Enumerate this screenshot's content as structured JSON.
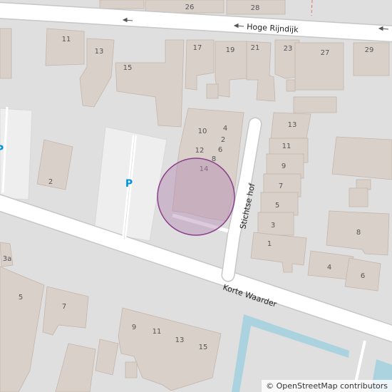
{
  "colors": {
    "land": "#e0dfdf",
    "building": "#d9d0c9",
    "building_stroke": "#c4b6ab",
    "road": "#ffffff",
    "road_casing": "#c7c7c7",
    "parking": "#eeeeee",
    "water": "#aad3df",
    "parking_icon": "#0092da",
    "marker_fill": "#b48ab4",
    "marker_stroke": "#8a3f8a"
  },
  "streets": {
    "hoge_rijndijk": "Hoge Rijndijk",
    "stichtse_hof": "Stichtse hof",
    "korte_waarder": "Korte Waarder"
  },
  "parking_label": "P",
  "house_numbers": [
    "26",
    "28",
    "11",
    "13",
    "15",
    "17",
    "19",
    "21",
    "23",
    "27",
    "29",
    "10",
    "4",
    "2",
    "12",
    "6",
    "8",
    "14",
    "13",
    "11",
    "9",
    "7",
    "5",
    "3",
    "1",
    "8",
    "4",
    "6",
    "2",
    "3a",
    "5",
    "7",
    "9",
    "11",
    "13",
    "15"
  ],
  "attribution": "© OpenStreetMap contributors",
  "marker": {
    "shape": "circle"
  }
}
